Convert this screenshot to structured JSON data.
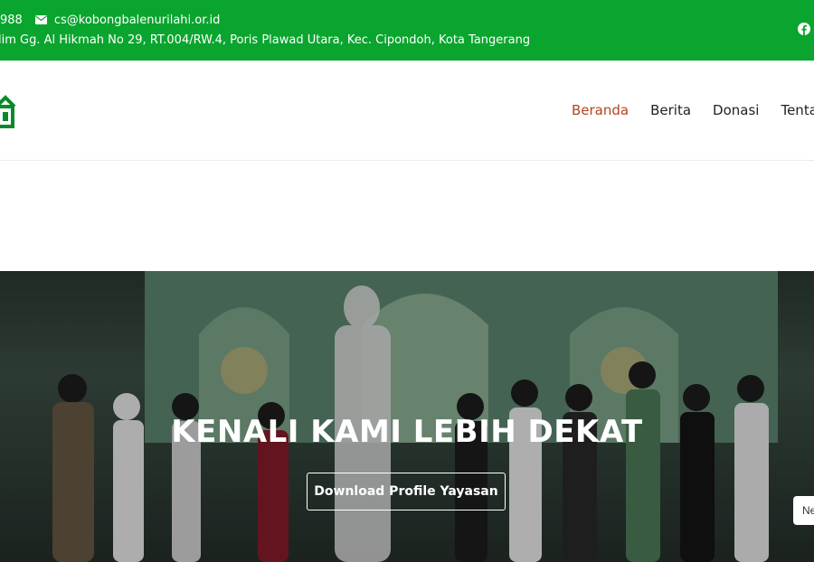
{
  "topbar": {
    "phone_partial": "988",
    "email": "cs@kobongbalenurilahi.or.id",
    "address": "lim Gg. Al Hikmah No 29, RT.004/RW.4, Poris Plawad Utara, Kec. Cipondoh, Kota Tangerang",
    "social_icon": "facebook-icon"
  },
  "nav": {
    "items": [
      "Beranda",
      "Berita",
      "Donasi",
      "Tenta"
    ],
    "active_index": 0
  },
  "hero": {
    "heading": "KENALI KAMI LEBIH DEKAT",
    "button_label": "Download Profile Yayasan",
    "side_chip_label": "Ne"
  },
  "colors": {
    "topbar_bg": "#0aa52e",
    "nav_active": "#b5431e",
    "text_dark": "#222222"
  }
}
